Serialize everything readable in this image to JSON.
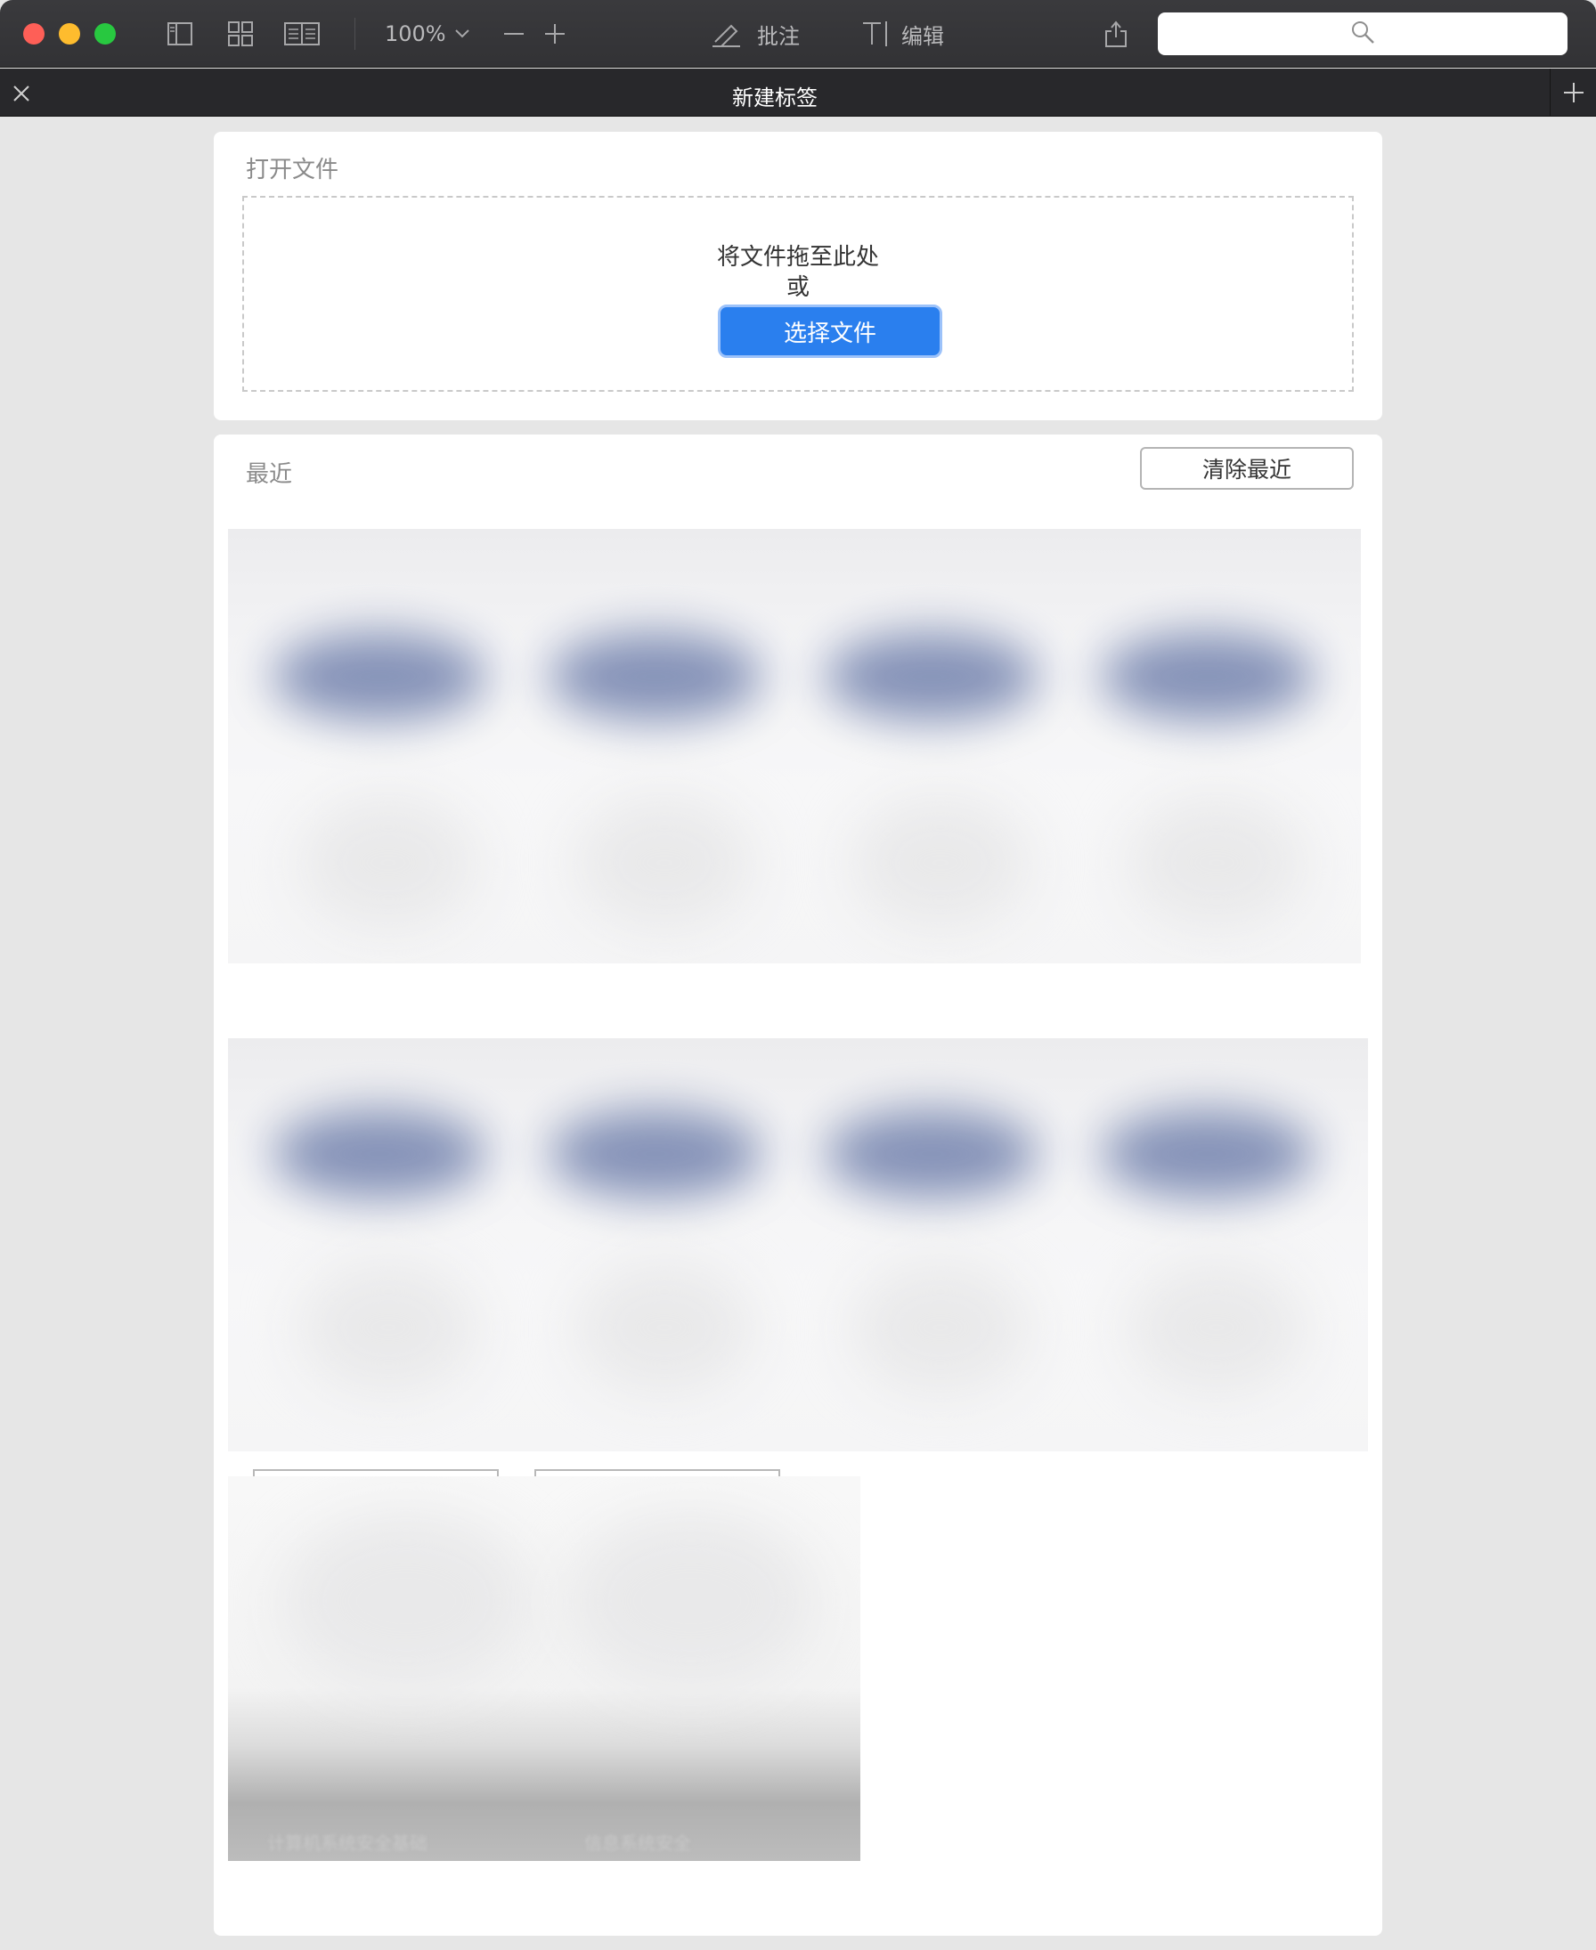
{
  "toolbar": {
    "zoom_label": "100%",
    "annotate_label": "批注",
    "edit_label": "编辑",
    "search_placeholder": ""
  },
  "tab": {
    "title": "新建标签"
  },
  "open_file": {
    "heading": "打开文件",
    "drop_text": "将文件拖至此处",
    "or_text": "或",
    "choose_button": "选择文件"
  },
  "recent": {
    "heading": "最近",
    "clear_button": "清除最近",
    "file_labels": [
      "计算机系统安全基础",
      "信息系统安全"
    ]
  },
  "colors": {
    "accent": "#2a7fee",
    "toolbar_bg": "#36363a",
    "tabbar_bg": "#28282b",
    "page_bg": "#e6e6e6"
  }
}
